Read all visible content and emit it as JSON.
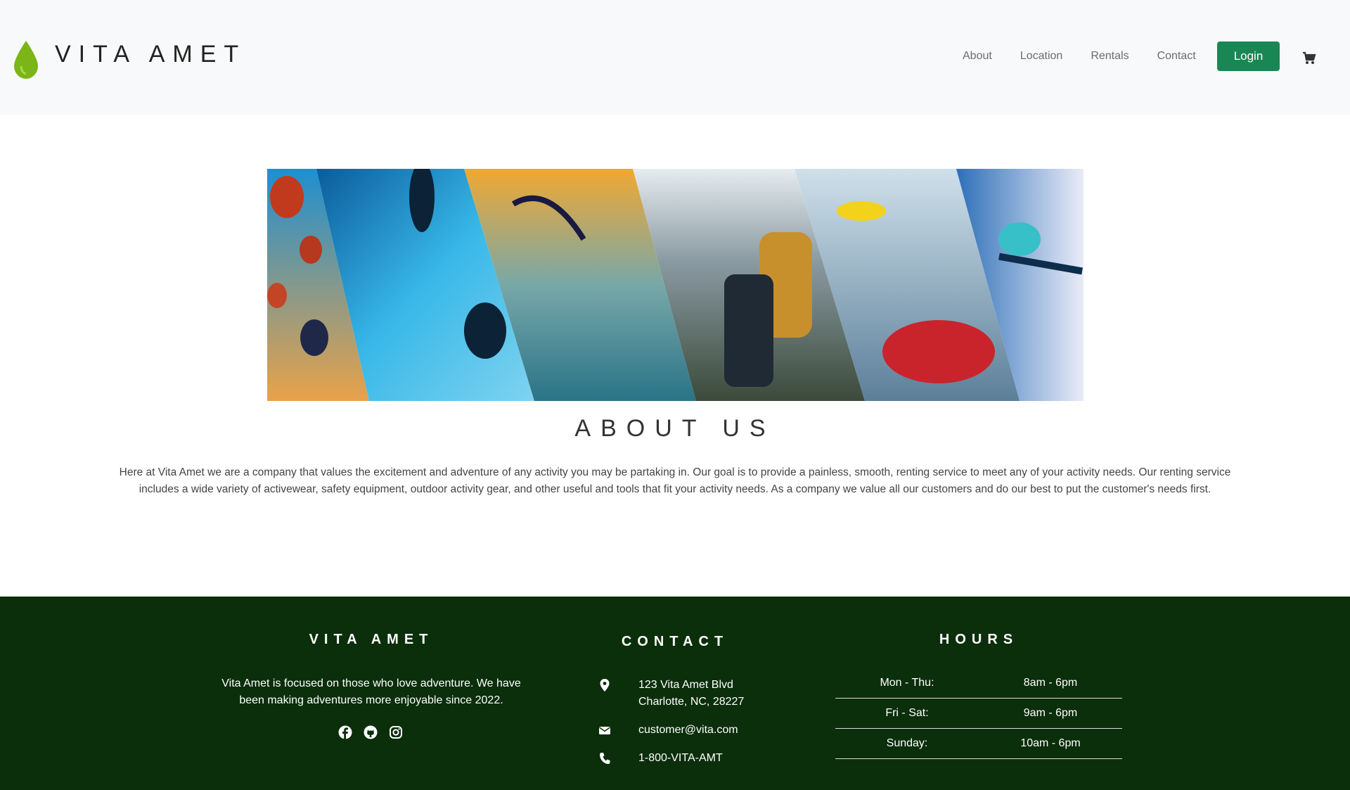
{
  "header": {
    "brand": "VITA AMET",
    "nav": [
      "About",
      "Location",
      "Rentals",
      "Contact"
    ],
    "login_label": "Login",
    "colors": {
      "logo": "#7cb518",
      "login": "#198754"
    }
  },
  "about": {
    "title": "ABOUT US",
    "body": "Here at Vita Amet we are a company that values the excitement and adventure of any activity you may be partaking in. Our goal is to provide a painless, smooth, renting service to meet any of your activity needs. Our renting service includes a wide variety of activewear, safety equipment, outdoor activity gear, and other useful and tools that fit your activity needs. As a company we value all our customers and do our best to put the customer's needs first."
  },
  "footer": {
    "brand_title": "VITA AMET",
    "description": "Vita Amet is focused on those who love adventure. We have been making adventures more enjoyable since 2022.",
    "social_icons": [
      "facebook-icon",
      "github-icon",
      "instagram-icon"
    ],
    "contact_title": "CONTACT",
    "address_line1": "123 Vita Amet Blvd",
    "address_line2": "Charlotte, NC, 28227",
    "email": "customer@vita.com",
    "phone": "1-800-VITA-AMT",
    "hours_title": "HOURS",
    "hours": [
      {
        "day": "Mon - Thu:",
        "time": "8am - 6pm"
      },
      {
        "day": "Fri - Sat:",
        "time": "9am - 6pm"
      },
      {
        "day": "Sunday:",
        "time": "10am - 6pm"
      }
    ],
    "background": "#0b2e0b"
  }
}
